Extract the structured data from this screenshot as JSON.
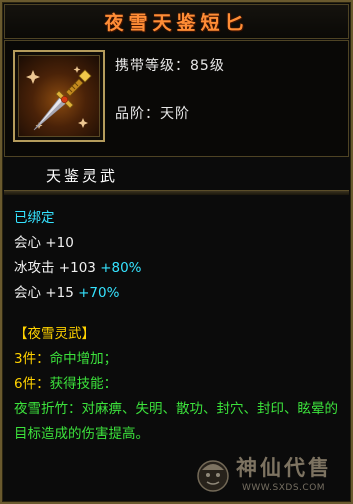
{
  "item": {
    "name": "夜雪天鉴短匕",
    "level_label": "携带等级：",
    "level_value": "85级",
    "grade_label": "品阶：",
    "grade_value": "天阶",
    "icon": "dagger-icon",
    "subtitle": "天鉴灵武"
  },
  "stats": {
    "bound_status": "已绑定",
    "lines": [
      {
        "name": "会心",
        "base": "+10",
        "bonus": ""
      },
      {
        "name": "冰攻击",
        "base": "+103",
        "bonus": "+80%"
      },
      {
        "name": "会心",
        "base": "+15",
        "bonus": "+70%"
      }
    ]
  },
  "set": {
    "title": "【夜雪灵武】",
    "tiers": [
      {
        "count": "3件：",
        "effect": "命中增加；"
      },
      {
        "count": "6件：",
        "effect": "获得技能："
      }
    ],
    "skill_text": "夜雪折竹：对麻痹、失明、散功、封穴、封印、眩晕的目标造成的伤害提高。"
  },
  "watermark": {
    "brand": "神仙代售",
    "url": "WWW.SXDS.COM",
    "icon": "mascot-logo-icon"
  },
  "colors": {
    "title": "#ff8d36",
    "stat_bonus": "#35e3ff",
    "set_title": "#ffd200",
    "set_text": "#3ce23c",
    "border": "#6a5a2e"
  }
}
